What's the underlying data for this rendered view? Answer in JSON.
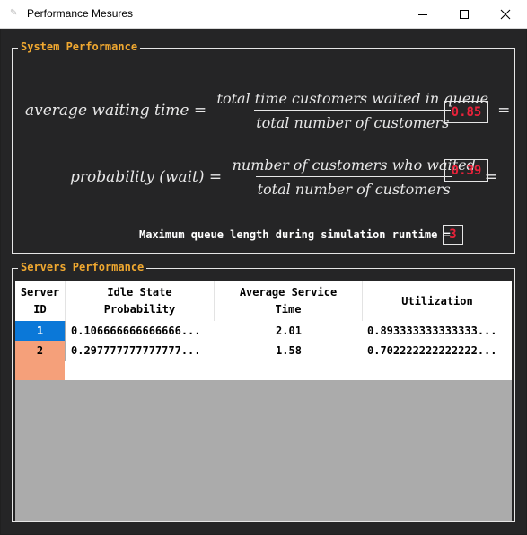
{
  "window": {
    "title": "Performance Mesures",
    "icon": "app-feather-icon"
  },
  "system": {
    "legend": "System Performance",
    "avg_wait": {
      "lhs": "average waiting time = ",
      "numerator": "total time customers waited in queue",
      "denominator": "total number of customers",
      "equals": "=",
      "value": "0.85"
    },
    "prob_wait": {
      "lhs": "probability (wait) = ",
      "numerator": "number of customers who waited",
      "denominator": "total number of customers",
      "equals": "=",
      "value": "0.39"
    },
    "max_queue": {
      "label": "Maximum queue length during simulation runtime =",
      "value": "3"
    }
  },
  "servers": {
    "legend": "Servers Performance",
    "columns": [
      "Server\nID",
      "Idle State\nProbability",
      "Average Service\nTime",
      "Utilization"
    ],
    "rows": [
      {
        "id": "1",
        "idle": "0.106666666666666...",
        "avg_service": "2.01",
        "utilization": "0.893333333333333..."
      },
      {
        "id": "2",
        "idle": "0.297777777777777...",
        "avg_service": "1.58",
        "utilization": "0.702222222222222..."
      }
    ],
    "row_colors": [
      "#0b78d8",
      "#f5a07a"
    ]
  }
}
